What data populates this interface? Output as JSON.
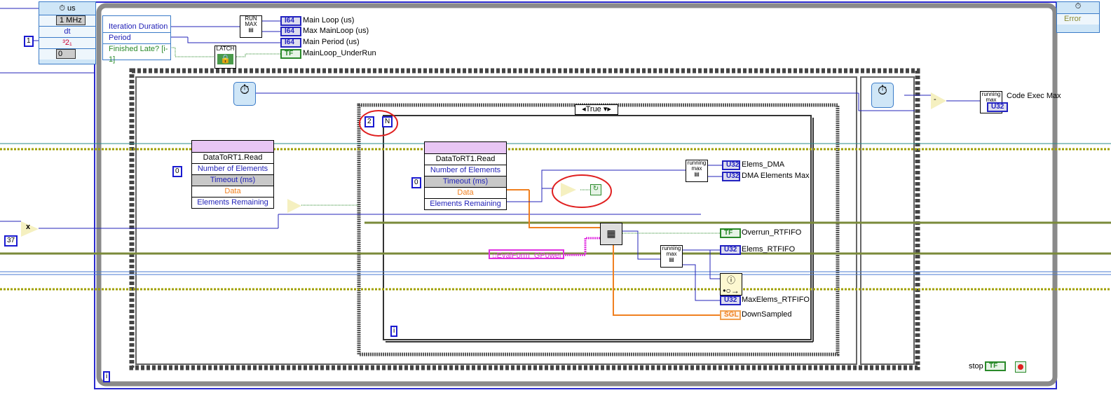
{
  "timed_loop_input": {
    "unit": "us",
    "clock": "1 MHz",
    "dt": "dt",
    "priority_glyph": "³2₁",
    "processor": "0",
    "dt_constant": "1"
  },
  "timed_loop_left_node": {
    "items": [
      "Iteration Duration",
      "Period",
      "Finished Late? [i-1]"
    ]
  },
  "run_max": {
    "label": "RUN MAX"
  },
  "latch": {
    "label": "LATCH"
  },
  "indicators_top": [
    {
      "type": "I64",
      "label": "Main Loop (us)"
    },
    {
      "type": "I64",
      "label": "Max MainLoop (us)"
    },
    {
      "type": "I64",
      "label": "Main Period (us)"
    },
    {
      "type": "TF",
      "label": "MainLoop_UnderRun"
    }
  ],
  "right_node": {
    "item": "Error"
  },
  "multiply": {
    "constant": "37",
    "op": "x"
  },
  "fifo_read_outer": {
    "title": "DataToRT1.Read",
    "rows": [
      "Number of Elements",
      "Timeout (ms)",
      "Data",
      "Elements Remaining"
    ],
    "timeout_const": "0"
  },
  "fifo_read_inner": {
    "title": "DataToRT1.Read",
    "rows": [
      "Number of Elements",
      "Timeout (ms)",
      "Data",
      "Elements Remaining"
    ],
    "timeout_const": "0"
  },
  "case_selector": "True",
  "wait_const": "2",
  "wait_glyph": "N",
  "running_max_label": "running max",
  "inner_indicators": [
    {
      "type": "U32",
      "label": "Elems_DMA"
    },
    {
      "type": "U32",
      "label": "DMA Elements Max"
    },
    {
      "type": "TF",
      "label": "Overrun_RTFIFO"
    },
    {
      "type": "U32",
      "label": "Elems_RTFIFO"
    },
    {
      "type": "U32",
      "label": "MaxElems_RTFIFO"
    },
    {
      "type": "SGL",
      "label": "DownSampled"
    }
  ],
  "global_var": "EvalForm_GPower",
  "code_exec": {
    "label": "Code Exec Max",
    "type": "U32",
    "op": "-"
  },
  "iteration_terminal": "i",
  "stop": {
    "label": "stop",
    "type": "TF"
  },
  "annotation_color": "#e02020"
}
